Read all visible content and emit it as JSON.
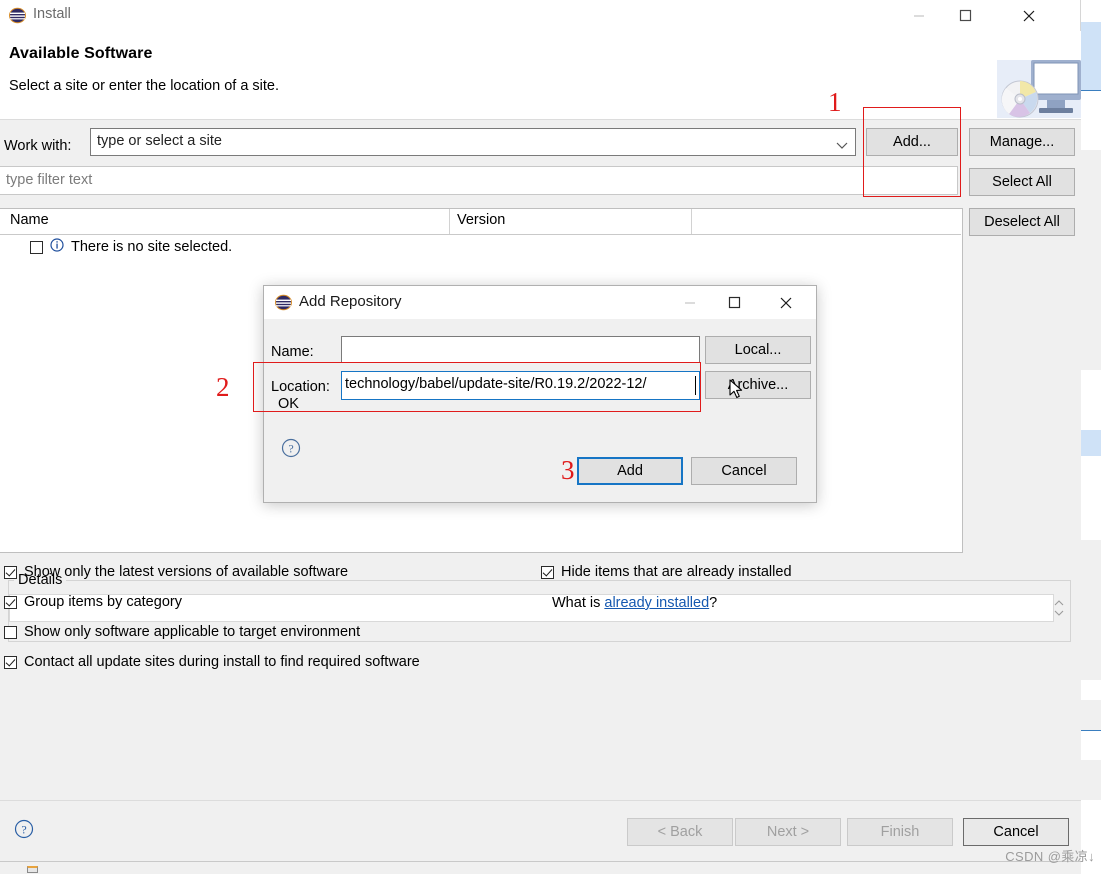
{
  "window": {
    "title": "Install",
    "icon": "eclipse-sphere-icon",
    "controls": {
      "minimize": "minimize-icon",
      "maximize": "maximize-icon",
      "close": "close-icon"
    }
  },
  "header": {
    "title": "Available Software",
    "subtitle": "Select a site or enter the location of a site.",
    "graphic": "monitor-cd-icon"
  },
  "work_with": {
    "label": "Work with:",
    "value": "type or select a site",
    "chevron": "chevron-down-icon",
    "add_label": "Add...",
    "manage_label": "Manage..."
  },
  "filter": {
    "placeholder": "type filter text",
    "value": ""
  },
  "table": {
    "columns": [
      "Name",
      "Version"
    ],
    "rows": [
      {
        "checked": false,
        "icon": "info-icon",
        "name": "There is no site selected.",
        "version": ""
      }
    ]
  },
  "side_buttons": {
    "select_all": "Select All",
    "deselect_all": "Deselect All"
  },
  "details": {
    "label": "Details",
    "value": "",
    "scroll_icon": "spinner-arrows-icon"
  },
  "options": [
    {
      "label": "Show only the latest versions of available software",
      "checked": true
    },
    {
      "label": "Group items by category",
      "checked": true
    },
    {
      "label": "Show only software applicable to target environment",
      "checked": false
    },
    {
      "label": "Contact all update sites during install to find required software",
      "checked": true
    },
    {
      "label": "Hide items that are already installed",
      "checked": true
    }
  ],
  "what_is": {
    "prefix": "What is ",
    "link": "already installed",
    "suffix": "?"
  },
  "footer": {
    "help": "help-icon",
    "back": "< Back",
    "next": "Next >",
    "finish": "Finish",
    "cancel": "Cancel"
  },
  "dialog": {
    "title": "Add Repository",
    "icon": "eclipse-sphere-icon",
    "controls": {
      "minimize": "minimize-icon",
      "maximize": "maximize-icon",
      "close": "close-icon"
    },
    "name_label": "Name:",
    "name_value": "",
    "location_label": "Location:",
    "location_value": "technology/babel/update-site/R0.19.2/2022-12/",
    "local_label": "Local...",
    "archive_label": "Archive...",
    "status_text": "OK",
    "help": "help-icon",
    "add_label": "Add",
    "cancel_label": "Cancel",
    "cursor": "mouse-pointer-icon"
  },
  "annotations": {
    "one": "1",
    "two": "2",
    "three": "3",
    "color": "#e01b1b"
  },
  "watermark": "CSDN @乘凉↓"
}
